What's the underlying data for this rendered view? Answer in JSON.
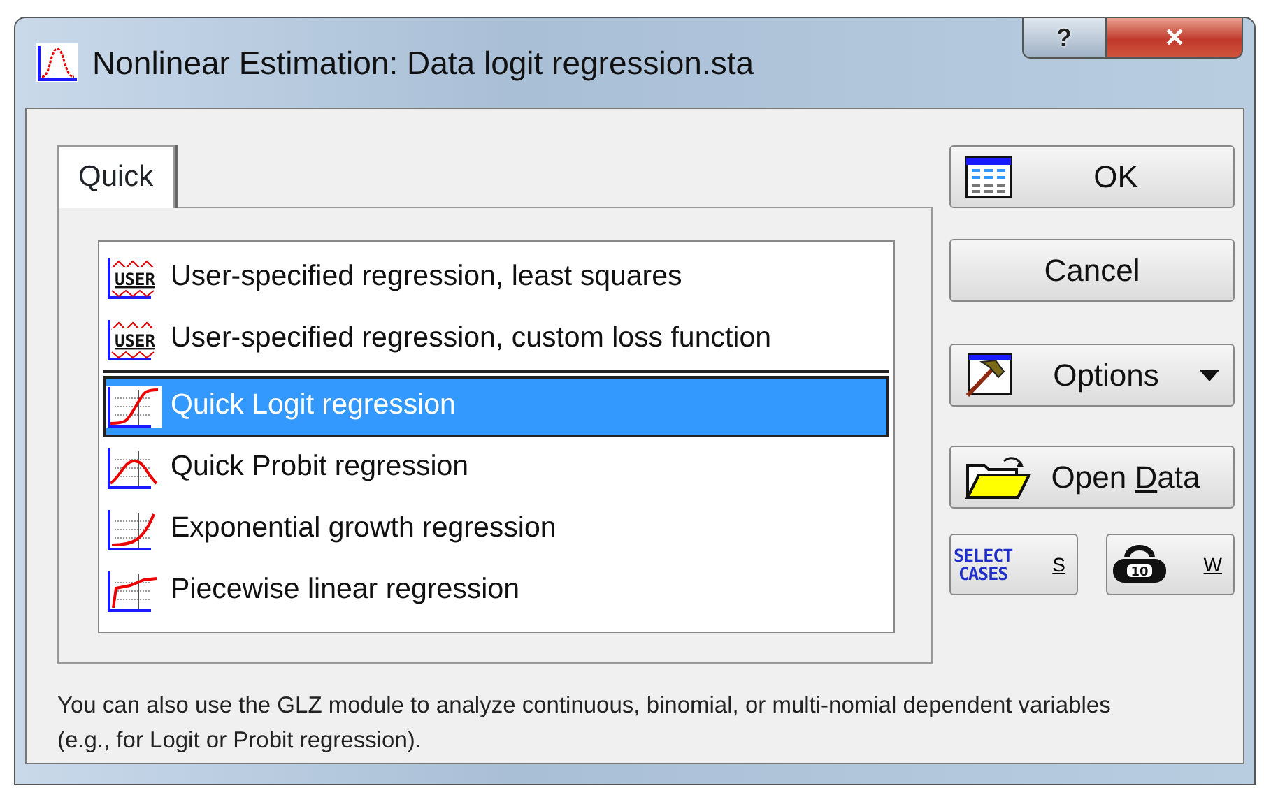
{
  "window": {
    "title": "Nonlinear Estimation: Data logit regression.sta",
    "help": "?",
    "close": "✕"
  },
  "tabs": [
    {
      "label": "Quick",
      "selected": true
    }
  ],
  "methods": [
    {
      "label": "User-specified regression, least squares",
      "kind": "user",
      "icon_text": "USER",
      "selected": false
    },
    {
      "label": "User-specified regression, custom loss function",
      "kind": "user",
      "icon_text": "USER",
      "selected": false
    },
    {
      "label": "Quick Logit regression",
      "kind": "logit",
      "selected": true
    },
    {
      "label": "Quick Probit regression",
      "kind": "probit",
      "selected": false
    },
    {
      "label": "Exponential growth regression",
      "kind": "exponential",
      "selected": false
    },
    {
      "label": "Piecewise linear regression",
      "kind": "piecewise",
      "selected": false
    }
  ],
  "buttons": [
    {
      "kind": "ok",
      "parts": [
        {
          "text": "OK",
          "underlined": false
        }
      ]
    },
    {
      "kind": "cancel",
      "parts": [
        {
          "text": "Cancel",
          "underlined": false
        }
      ]
    },
    {
      "kind": "options",
      "parts": [
        {
          "text": "Options",
          "underlined": false
        }
      ],
      "dropdown": true
    },
    {
      "kind": "open",
      "parts": [
        {
          "text": "Open ",
          "underlined": false
        },
        {
          "text": "D",
          "underlined": true
        },
        {
          "text": "ata",
          "underlined": false
        }
      ]
    },
    {
      "kind": "select",
      "icon_text": "SELECT CASES",
      "parts": [
        {
          "text": "S",
          "underlined": true
        }
      ]
    },
    {
      "kind": "weight",
      "icon_text": "10",
      "parts": [
        {
          "text": "W",
          "underlined": true
        }
      ]
    }
  ],
  "note": "You can also use the GLZ module to analyze continuous, binomial, or multi-nomial dependent variables (e.g., for Logit or Probit regression)."
}
